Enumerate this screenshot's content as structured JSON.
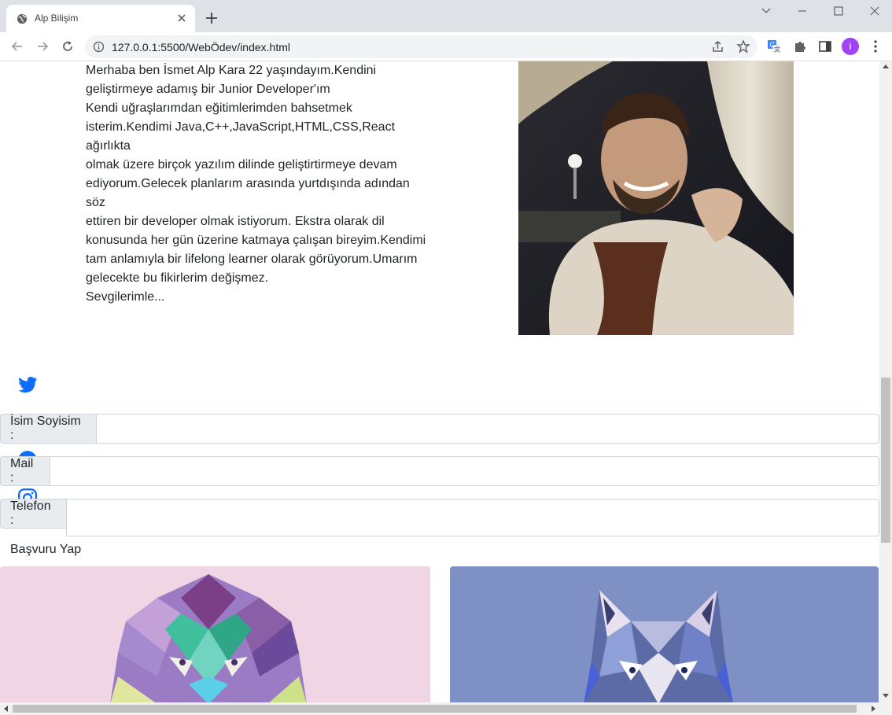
{
  "browser": {
    "tab_title": "Alp Bilişim",
    "url": "127.0.0.1:5500/WebÖdev/index.html",
    "profile_initial": "i"
  },
  "about": {
    "lines": [
      "Merhaba ben İsmet Alp Kara 22 yaşındayım.Kendini",
      "geliştirmeye adamış bir Junior Developer'ım",
      "Kendi uğraşlarımdan eğitimlerimden bahsetmek",
      "isterim.Kendimi Java,C++,JavaScript,HTML,CSS,React ağırlıkta",
      "olmak üzere birçok yazılım dilinde geliştirtirmeye devam",
      "ediyorum.Gelecek planlarım arasında yurtdışında adından söz",
      "ettiren bir developer olmak istiyorum. Ekstra olarak dil",
      "konusunda her gün üzerine katmaya çalışan bireyim.Kendimi",
      "tam anlamıyla bir lifelong learner olarak görüyorum.Umarım",
      "gelecekte bu fikirlerim değişmez.",
      "Sevgilerimle..."
    ]
  },
  "form": {
    "name_label": "İsim Soyisim :",
    "mail_label": "Mail :",
    "phone_label": "Telefon :",
    "name_value": "",
    "mail_value": "",
    "phone_value": "",
    "submit_label": "Başvuru Yap"
  },
  "social": {
    "icons": [
      "twitter-icon",
      "linkedin-icon",
      "github-icon",
      "instagram-icon"
    ],
    "color": "#0d6efd"
  },
  "cards": {
    "left_bg": "#f0d6e4",
    "right_bg": "#7f90c4"
  }
}
